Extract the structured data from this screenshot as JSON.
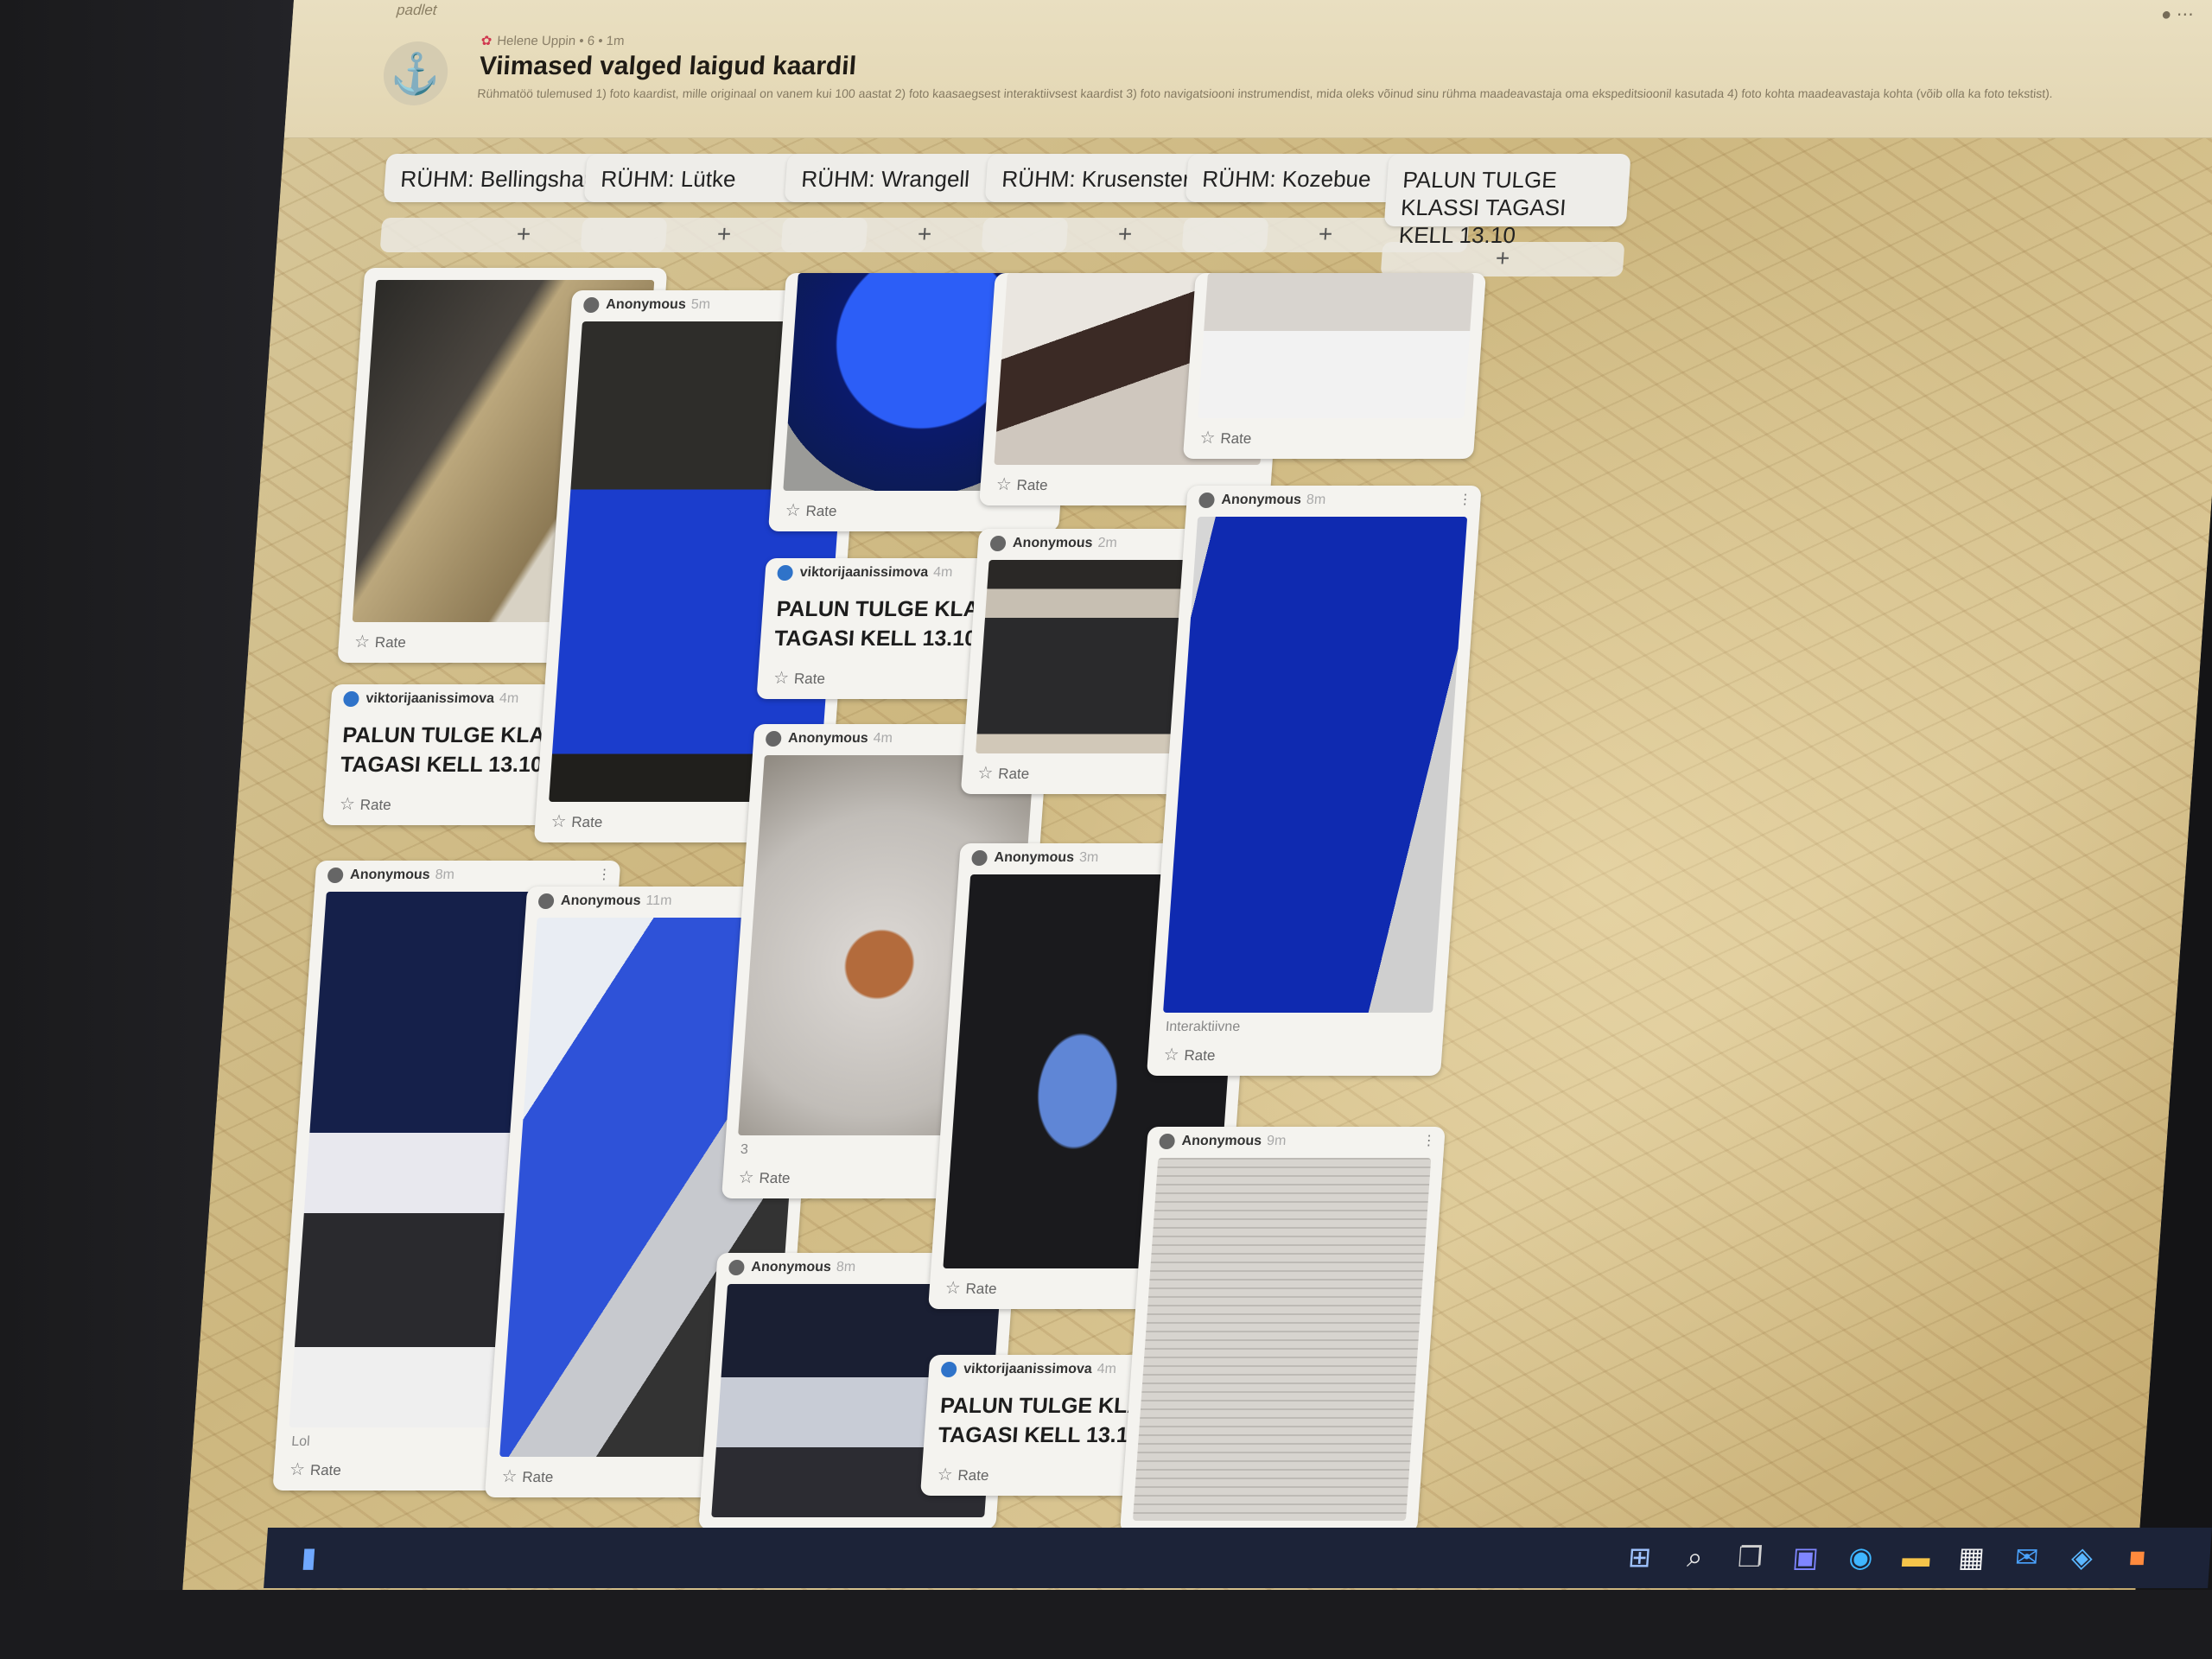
{
  "header": {
    "brand": "padlet",
    "author": "Helene Uppin",
    "meta": "• 6 • 1m",
    "title": "Viimased valged laigud kaardil",
    "description": "Rühmatöö tulemused 1) foto kaardist, mille originaal on vanem kui 100 aastat 2) foto kaasaegsest interaktiivsest kaardist 3) foto navigatsiooni instrumendist, mida oleks võinud sinu rühma maadeavastaja oma ekspeditsioonil kasutada 4) foto kohta maadeavastaja kohta (võib olla ka foto tekstist)."
  },
  "labels": {
    "rate": "Rate",
    "add": "+",
    "menu": "⋮"
  },
  "columns": [
    {
      "title": "RÜHM: Bellingshausen"
    },
    {
      "title": "RÜHM: Lütke"
    },
    {
      "title": "RÜHM: Wrangell"
    },
    {
      "title": "RÜHM: Krusenstern"
    },
    {
      "title": "RÜHM: Kozebue"
    },
    {
      "title": "PALUN TULGE KLASSI TAGASI KELL 13.10"
    }
  ],
  "cards": {
    "c1a": {
      "caption": ""
    },
    "c1b": {
      "author": "viktorijaanissimova",
      "time": "4m",
      "text": "PALUN TULGE KLASSI TAGASI KELL 13.10"
    },
    "c1c": {
      "author": "Anonymous",
      "time": "8m",
      "caption": "Lol"
    },
    "c2a": {
      "author": "Anonymous",
      "time": "5m"
    },
    "c2b": {
      "author": "Anonymous",
      "time": "11m"
    },
    "c3a": {
      "caption": ""
    },
    "c3b": {
      "author": "viktorijaanissimova",
      "time": "4m",
      "text": "PALUN TULGE KLASSI TAGASI KELL 13.10"
    },
    "c3c": {
      "author": "Anonymous",
      "time": "4m",
      "caption": "3"
    },
    "c3d": {
      "author": "Anonymous",
      "time": "8m"
    },
    "c4b": {
      "author": "Anonymous",
      "time": "2m"
    },
    "c4c": {
      "author": "Anonymous",
      "time": "3m"
    },
    "c4d": {
      "author": "viktorijaanissimova",
      "time": "4m",
      "text": "PALUN TULGE KLASSI TAGASI KELL 13.10"
    },
    "c5b": {
      "author": "Anonymous",
      "time": "8m",
      "caption": "Interaktiivne"
    },
    "c5c": {
      "author": "Anonymous",
      "time": "9m"
    }
  }
}
